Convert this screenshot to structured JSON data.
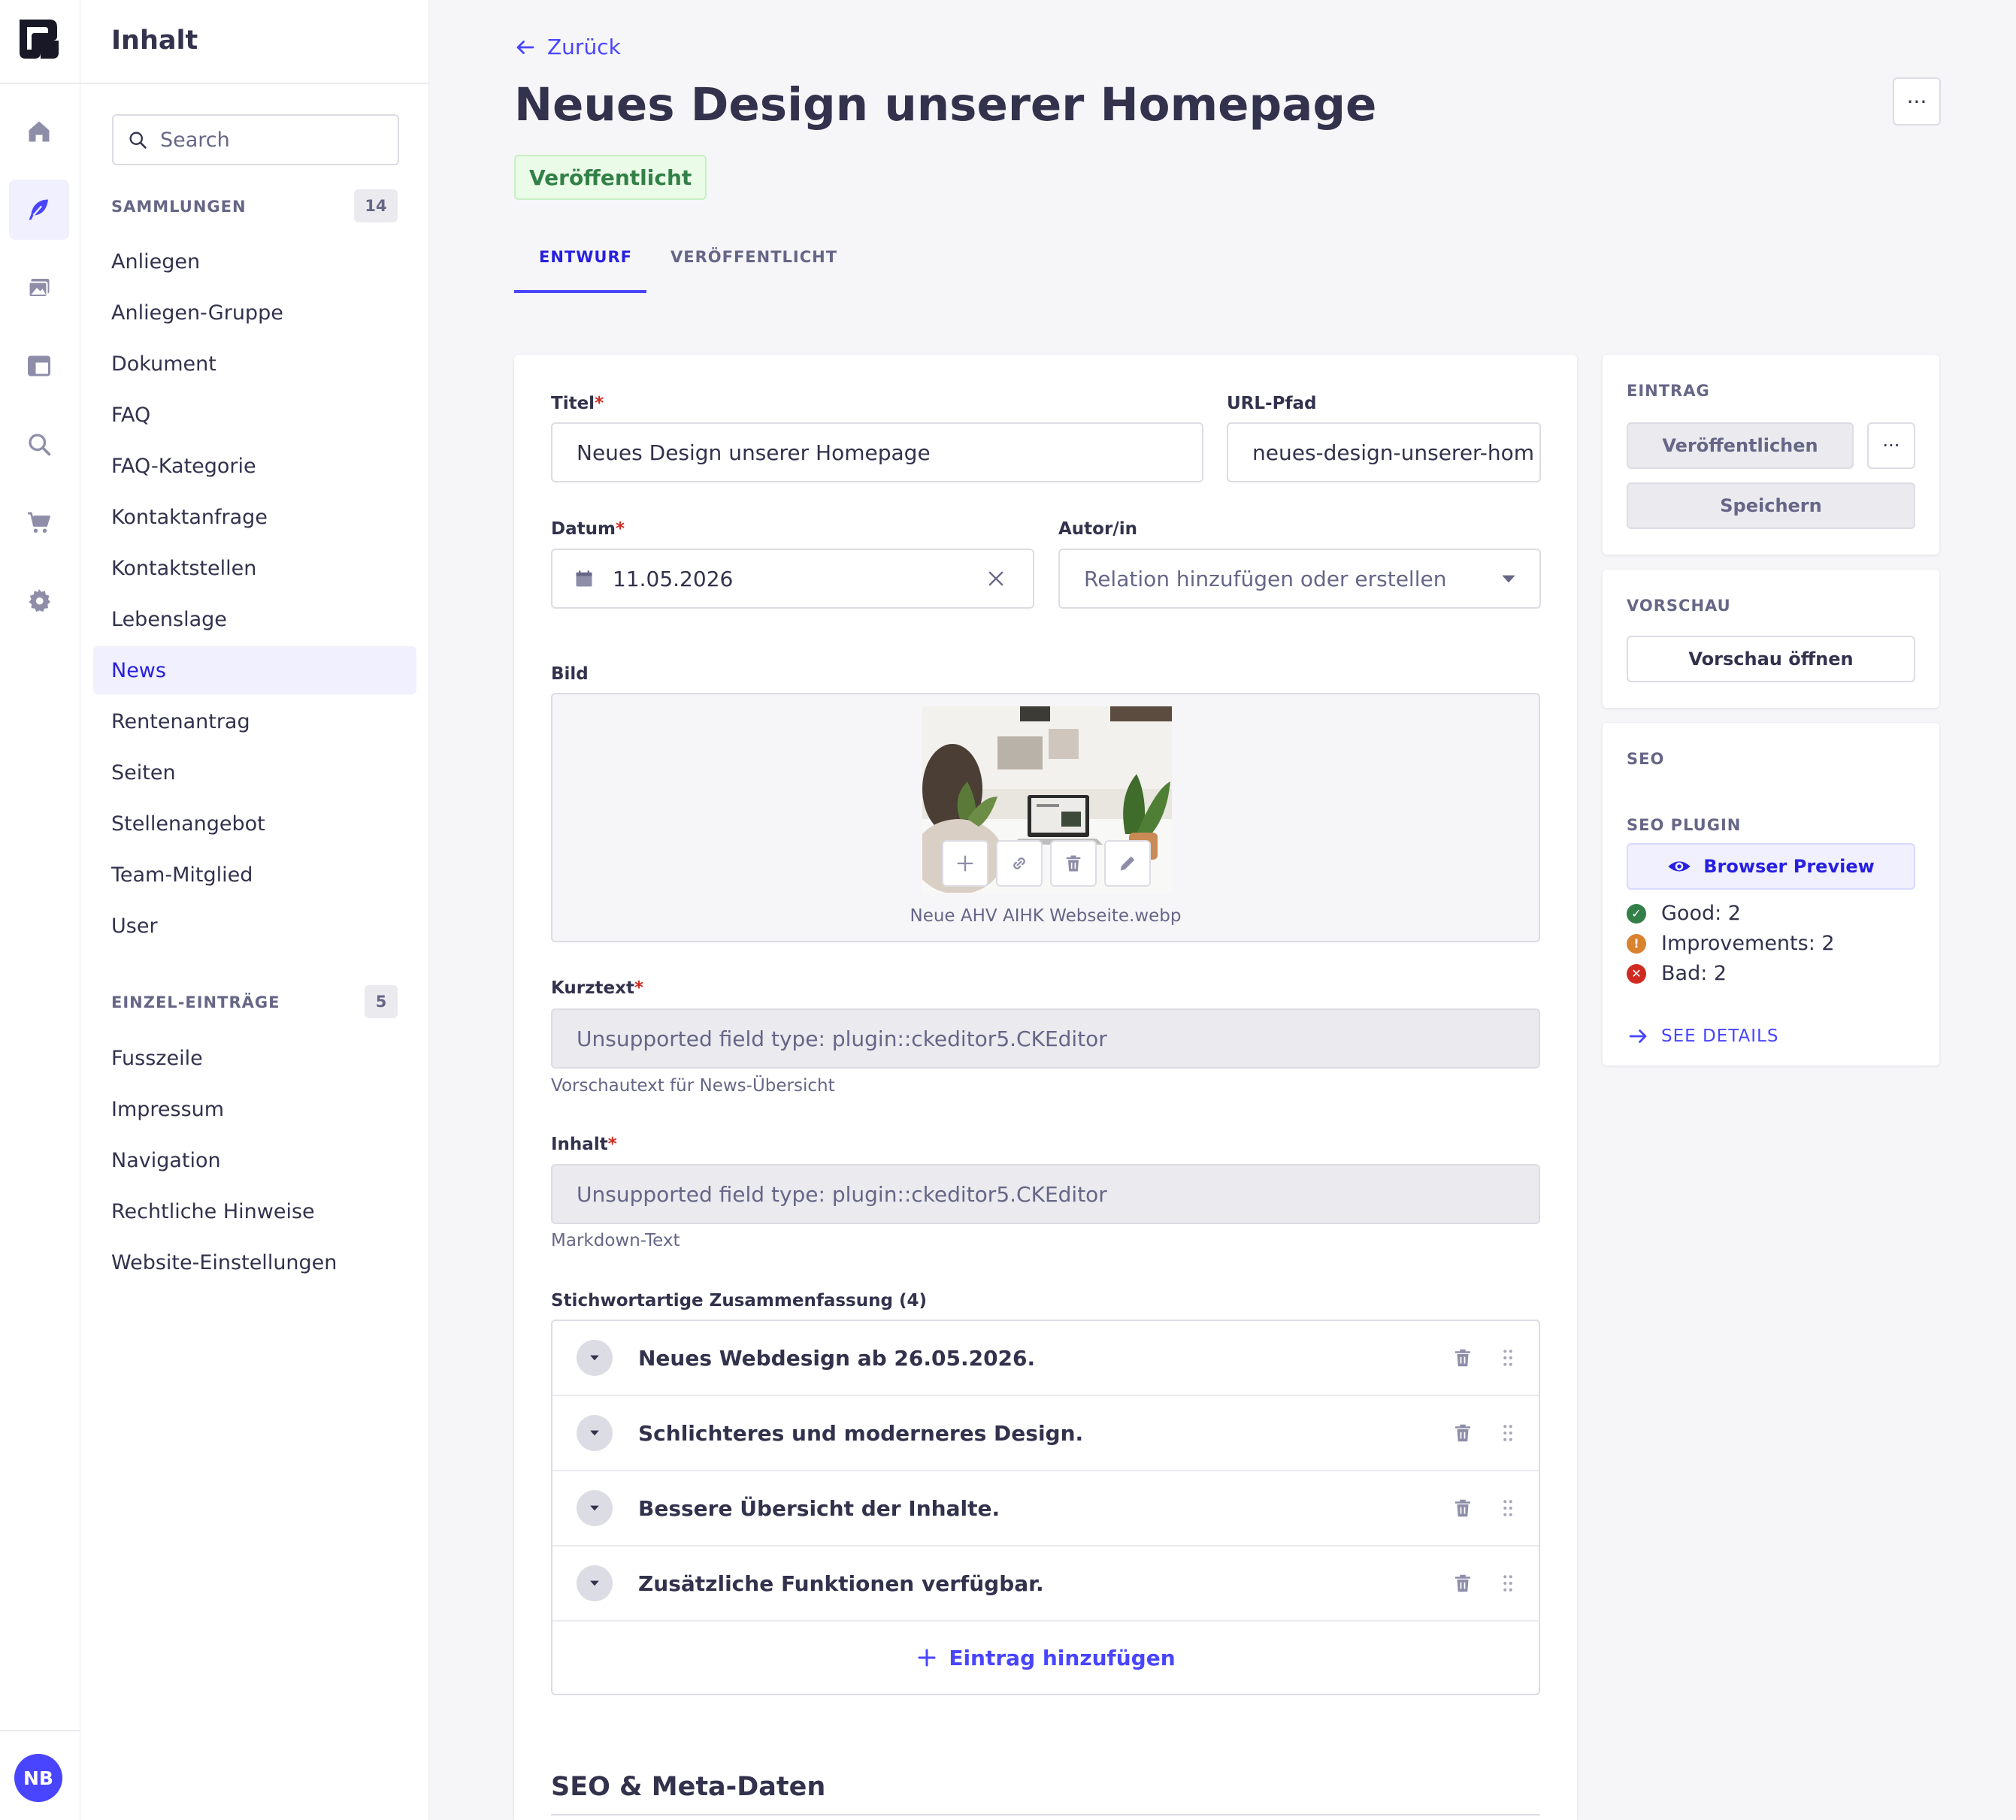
{
  "rail": {
    "avatar_initials": "NB"
  },
  "nav": {
    "title": "Inhalt",
    "search_placeholder": "Search",
    "collections_label": "SAMMLUNGEN",
    "collections_count": "14",
    "collections": [
      "Anliegen",
      "Anliegen-Gruppe",
      "Dokument",
      "FAQ",
      "FAQ-Kategorie",
      "Kontaktanfrage",
      "Kontaktstellen",
      "Lebenslage",
      "News",
      "Rentenantrag",
      "Seiten",
      "Stellenangebot",
      "Team-Mitglied",
      "User"
    ],
    "active_collection": "News",
    "single_label": "EINZEL-EINTRÄGE",
    "single_count": "5",
    "singles": [
      "Fusszeile",
      "Impressum",
      "Navigation",
      "Rechtliche Hinweise",
      "Website-Einstellungen"
    ]
  },
  "header": {
    "back_label": "Zurück",
    "title": "Neues Design unserer Homepage",
    "status": "Veröffentlicht",
    "more_label": "···",
    "tabs": [
      "ENTWURF",
      "VERÖFFENTLICHT"
    ]
  },
  "form": {
    "title_label": "Titel",
    "title_value": "Neues Design unserer Homepage",
    "url_label": "URL-Pfad",
    "url_value": "neues-design-unserer-hom",
    "date_label": "Datum",
    "date_value": "11.05.2026",
    "author_label": "Autor/in",
    "author_placeholder": "Relation hinzufügen oder erstellen",
    "image_label": "Bild",
    "image_filename": "Neue AHV AIHK Webseite.webp",
    "short_label": "Kurztext",
    "short_value": "Unsupported field type: plugin::ckeditor5.CKEditor",
    "short_hint": "Vorschautext für News-Übersicht",
    "content_label": "Inhalt",
    "content_value": "Unsupported field type: plugin::ckeditor5.CKEditor",
    "content_hint": "Markdown-Text",
    "summary_label": "Stichwortartige Zusammenfassung (4)",
    "summary_items": [
      "Neues Webdesign ab 26.05.2026.",
      "Schlichteres und moderneres Design.",
      "Bessere Übersicht der Inhalte.",
      "Zusätzliche Funktionen verfügbar."
    ],
    "add_entry_label": "Eintrag hinzufügen",
    "seo_heading": "SEO & Meta-Daten",
    "required_mark": "*"
  },
  "sidebar": {
    "entry_head": "EINTRAG",
    "publish_label": "Veröffentlichen",
    "more_label": "···",
    "save_label": "Speichern",
    "preview_head": "VORSCHAU",
    "preview_button": "Vorschau öffnen",
    "seo_head": "SEO",
    "seo_plugin_head": "SEO PLUGIN",
    "browser_preview": "Browser Preview",
    "good": "Good: 2",
    "improvements": "Improvements: 2",
    "bad": "Bad: 2",
    "see_details": "SEE DETAILS"
  },
  "colors": {
    "primary": "#4945ff",
    "success": "#328048",
    "warning": "#d9822f",
    "danger": "#d02b20"
  }
}
